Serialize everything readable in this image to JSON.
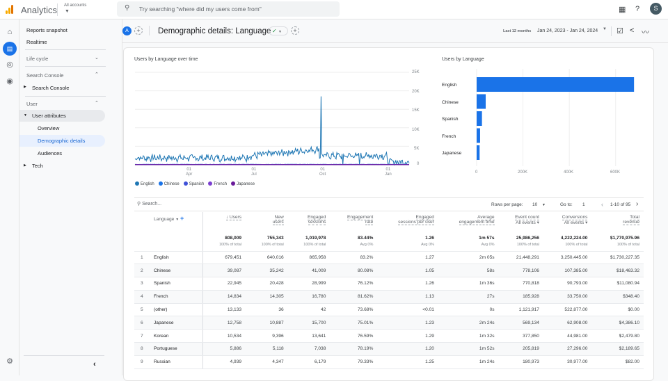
{
  "topbar": {
    "app_title": "Analytics",
    "account_label": "All accounts",
    "search_placeholder": "Try searching \"where did my users come from\"",
    "avatar_letter": "S"
  },
  "rail": {
    "icons": [
      "home-icon",
      "reports-icon",
      "explore-icon",
      "advertising-icon"
    ],
    "settings": "settings-icon"
  },
  "nav": {
    "reports_snapshot": "Reports snapshot",
    "realtime": "Realtime",
    "life_cycle": "Life cycle",
    "search_console_section": "Search Console",
    "search_console_item": "Search Console",
    "user_section": "User",
    "user_attributes": "User attributes",
    "overview": "Overview",
    "demographic_details": "Demographic details",
    "audiences": "Audiences",
    "tech": "Tech",
    "collapse": "‹"
  },
  "header": {
    "comparison_badge": "A",
    "title": "Demographic details: Language",
    "date_label": "Last 12 months",
    "date_range": "Jan 24, 2023 - Jan 24, 2024"
  },
  "line_chart": {
    "title": "Users by Language over time",
    "y_ticks": [
      "25K",
      "20K",
      "15K",
      "10K",
      "5K",
      "0"
    ],
    "x_ticks": [
      [
        "01",
        "Apr"
      ],
      [
        "01",
        "Jul"
      ],
      [
        "01",
        "Oct"
      ],
      [
        "01",
        "Jan"
      ]
    ],
    "legend": [
      {
        "name": "English",
        "color": "#1f77b4"
      },
      {
        "name": "Chinese",
        "color": "#1a73e8"
      },
      {
        "name": "Spanish",
        "color": "#3f51d8"
      },
      {
        "name": "French",
        "color": "#7b3fd0"
      },
      {
        "name": "Japanese",
        "color": "#6a1b9a"
      }
    ]
  },
  "chart_data": [
    {
      "type": "line",
      "title": "Users by Language over time",
      "ylim": [
        0,
        25000
      ],
      "y_ticks": [
        0,
        5000,
        10000,
        15000,
        20000,
        25000
      ],
      "x_tick_labels": [
        "01 Apr",
        "01 Jul",
        "01 Oct",
        "01 Jan"
      ],
      "series": [
        {
          "name": "English",
          "approx_baseline": 2000,
          "peak": {
            "x": "late Sep",
            "value": 18500
          }
        },
        {
          "name": "Chinese",
          "approx_baseline": 100
        },
        {
          "name": "Spanish",
          "approx_baseline": 60
        },
        {
          "name": "French",
          "approx_baseline": 40
        },
        {
          "name": "Japanese",
          "approx_baseline": 35
        }
      ]
    },
    {
      "type": "bar",
      "title": "Users by Language",
      "categories": [
        "English",
        "Chinese",
        "Spanish",
        "French",
        "Japanese"
      ],
      "values": [
        679451,
        39087,
        22945,
        14834,
        12758
      ],
      "x_ticks": [
        "0",
        "200K",
        "400K",
        "600K"
      ],
      "xlim": [
        0,
        700000
      ]
    }
  ],
  "table": {
    "search_placeholder": "Search...",
    "rows_per_page_label": "Rows per page:",
    "rows_per_page": "10",
    "goto_label": "Go to:",
    "goto_value": "1",
    "pagination": "1-10 of 95",
    "dimension": "Language",
    "columns": [
      [
        "↓ Users",
        ""
      ],
      [
        "New",
        "users"
      ],
      [
        "Engaged",
        "sessions"
      ],
      [
        "Engagement",
        "rate"
      ],
      [
        "Engaged",
        "sessions per user"
      ],
      [
        "Average",
        "engagement time"
      ],
      [
        "Event count",
        "All events ▾"
      ],
      [
        "Conversions",
        "All events ▾"
      ],
      [
        "Total",
        "revenue"
      ]
    ],
    "totals": [
      [
        "808,009",
        "100% of total"
      ],
      [
        "755,343",
        "100% of total"
      ],
      [
        "1,019,978",
        "100% of total"
      ],
      [
        "83.44%",
        "Avg 0%"
      ],
      [
        "1.26",
        "Avg 0%"
      ],
      [
        "1m 57s",
        "Avg 0%"
      ],
      [
        "25,986,256",
        "100% of total"
      ],
      [
        "4,222,224.00",
        "100% of total"
      ],
      [
        "$1,770,975.96",
        "100% of total"
      ]
    ],
    "rows": [
      [
        "1",
        "English",
        "679,451",
        "640,016",
        "865,958",
        "83.2%",
        "1.27",
        "2m 05s",
        "21,448,291",
        "3,250,445.00",
        "$1,730,227.35"
      ],
      [
        "2",
        "Chinese",
        "39,087",
        "35,242",
        "41,009",
        "80.08%",
        "1.05",
        "58s",
        "778,106",
        "107,385.00",
        "$18,463.32"
      ],
      [
        "3",
        "Spanish",
        "22,945",
        "20,428",
        "28,999",
        "76.12%",
        "1.26",
        "1m 36s",
        "770,818",
        "90,793.00",
        "$11,080.94"
      ],
      [
        "4",
        "French",
        "14,834",
        "14,305",
        "16,780",
        "81.62%",
        "1.13",
        "27s",
        "185,928",
        "33,750.00",
        "$348.40"
      ],
      [
        "5",
        "(other)",
        "13,133",
        "36",
        "42",
        "73.68%",
        "<0.01",
        "0s",
        "1,121,917",
        "522,877.00",
        "$0.00"
      ],
      [
        "6",
        "Japanese",
        "12,758",
        "10,887",
        "15,700",
        "75.01%",
        "1.23",
        "2m 24s",
        "569,134",
        "62,908.00",
        "$4,386.10"
      ],
      [
        "7",
        "Korean",
        "10,534",
        "9,396",
        "13,641",
        "76.59%",
        "1.29",
        "1m 32s",
        "377,850",
        "44,981.00",
        "$2,479.80"
      ],
      [
        "8",
        "Portuguese",
        "5,886",
        "5,118",
        "7,038",
        "78.19%",
        "1.20",
        "1m 52s",
        "205,819",
        "27,296.00",
        "$2,189.65"
      ],
      [
        "9",
        "Russian",
        "4,939",
        "4,347",
        "6,179",
        "79.33%",
        "1.25",
        "1m 24s",
        "180,973",
        "30,977.00",
        "$82.00"
      ]
    ]
  }
}
